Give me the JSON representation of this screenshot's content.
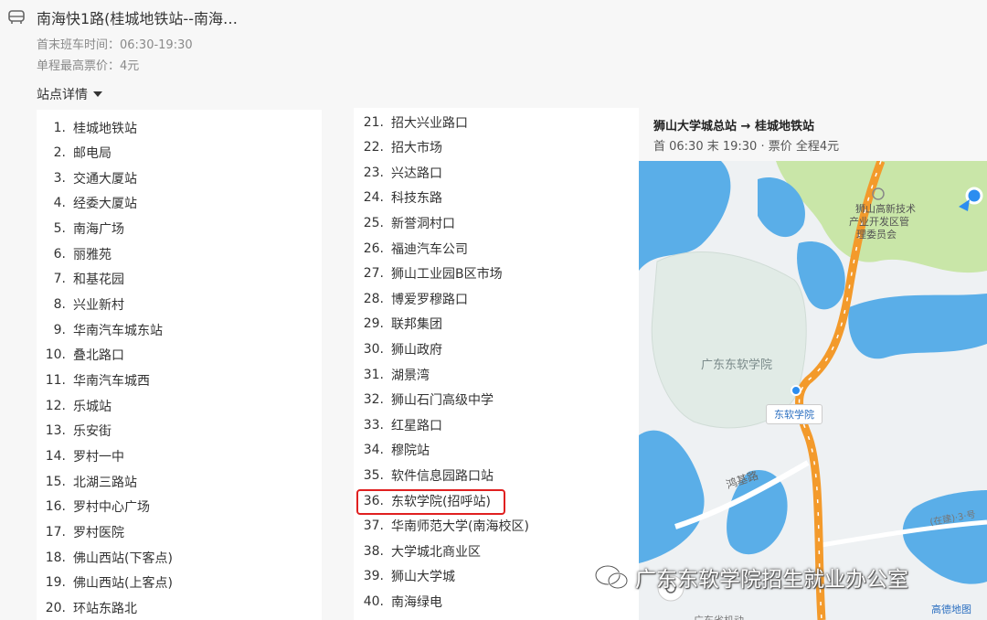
{
  "route": {
    "title": "南海快1路(桂城地铁站--南海…",
    "hours": "首末班车时间：06:30-19:30",
    "max_fare": "单程最高票价：4元",
    "details_label": "站点详情"
  },
  "stops_left": [
    {
      "num": "1.",
      "name": "桂城地铁站"
    },
    {
      "num": "2.",
      "name": "邮电局"
    },
    {
      "num": "3.",
      "name": "交通大厦站"
    },
    {
      "num": "4.",
      "name": "经委大厦站"
    },
    {
      "num": "5.",
      "name": "南海广场"
    },
    {
      "num": "6.",
      "name": "丽雅苑"
    },
    {
      "num": "7.",
      "name": "和基花园"
    },
    {
      "num": "8.",
      "name": "兴业新村"
    },
    {
      "num": "9.",
      "name": "华南汽车城东站"
    },
    {
      "num": "10.",
      "name": "叠北路口"
    },
    {
      "num": "11.",
      "name": "华南汽车城西"
    },
    {
      "num": "12.",
      "name": "乐城站"
    },
    {
      "num": "13.",
      "name": "乐安街"
    },
    {
      "num": "14.",
      "name": "罗村一中"
    },
    {
      "num": "15.",
      "name": "北湖三路站"
    },
    {
      "num": "16.",
      "name": "罗村中心广场"
    },
    {
      "num": "17.",
      "name": "罗村医院"
    },
    {
      "num": "18.",
      "name": "佛山西站(下客点)"
    },
    {
      "num": "19.",
      "name": "佛山西站(上客点)"
    },
    {
      "num": "20.",
      "name": "环站东路北"
    }
  ],
  "stops_right": [
    {
      "num": "21.",
      "name": "招大兴业路口"
    },
    {
      "num": "22.",
      "name": "招大市场"
    },
    {
      "num": "23.",
      "name": "兴达路口"
    },
    {
      "num": "24.",
      "name": "科技东路"
    },
    {
      "num": "25.",
      "name": "新誉洞村口"
    },
    {
      "num": "26.",
      "name": "福迪汽车公司"
    },
    {
      "num": "27.",
      "name": "狮山工业园B区市场"
    },
    {
      "num": "28.",
      "name": "博爱罗穆路口"
    },
    {
      "num": "29.",
      "name": "联邦集团"
    },
    {
      "num": "30.",
      "name": "狮山政府"
    },
    {
      "num": "31.",
      "name": "湖景湾"
    },
    {
      "num": "32.",
      "name": "狮山石门高级中学"
    },
    {
      "num": "33.",
      "name": "红星路口"
    },
    {
      "num": "34.",
      "name": "穆院站"
    },
    {
      "num": "35.",
      "name": "软件信息园路口站"
    },
    {
      "num": "36.",
      "name": "东软学院(招呼站)"
    },
    {
      "num": "37.",
      "name": "华南师范大学(南海校区)"
    },
    {
      "num": "38.",
      "name": "大学城北商业区"
    },
    {
      "num": "39.",
      "name": "狮山大学城"
    },
    {
      "num": "40.",
      "name": "南海绿电"
    }
  ],
  "route_panel": {
    "title": "狮山大学城总站 → 桂城地铁站",
    "subtitle": "首 06:30 末 19:30 · 票价 全程4元"
  },
  "map": {
    "label_campus": "广东东软学院",
    "label_stop": "东软学院",
    "label_road": "鸿基路",
    "label_zone_1": "狮山高新技术",
    "label_zone_2": "产业开发区管",
    "label_zone_3": "理委员会",
    "label_road2": "(在建)·3·号",
    "label_logo": "高德地图",
    "label_bottom": "广东省机动"
  },
  "watermark": "广东东软学院招生就业办公室",
  "colors": {
    "route": "#f39a2b",
    "water": "#5aaee8",
    "green": "#c9e6a8",
    "highlight": "#e02020"
  }
}
